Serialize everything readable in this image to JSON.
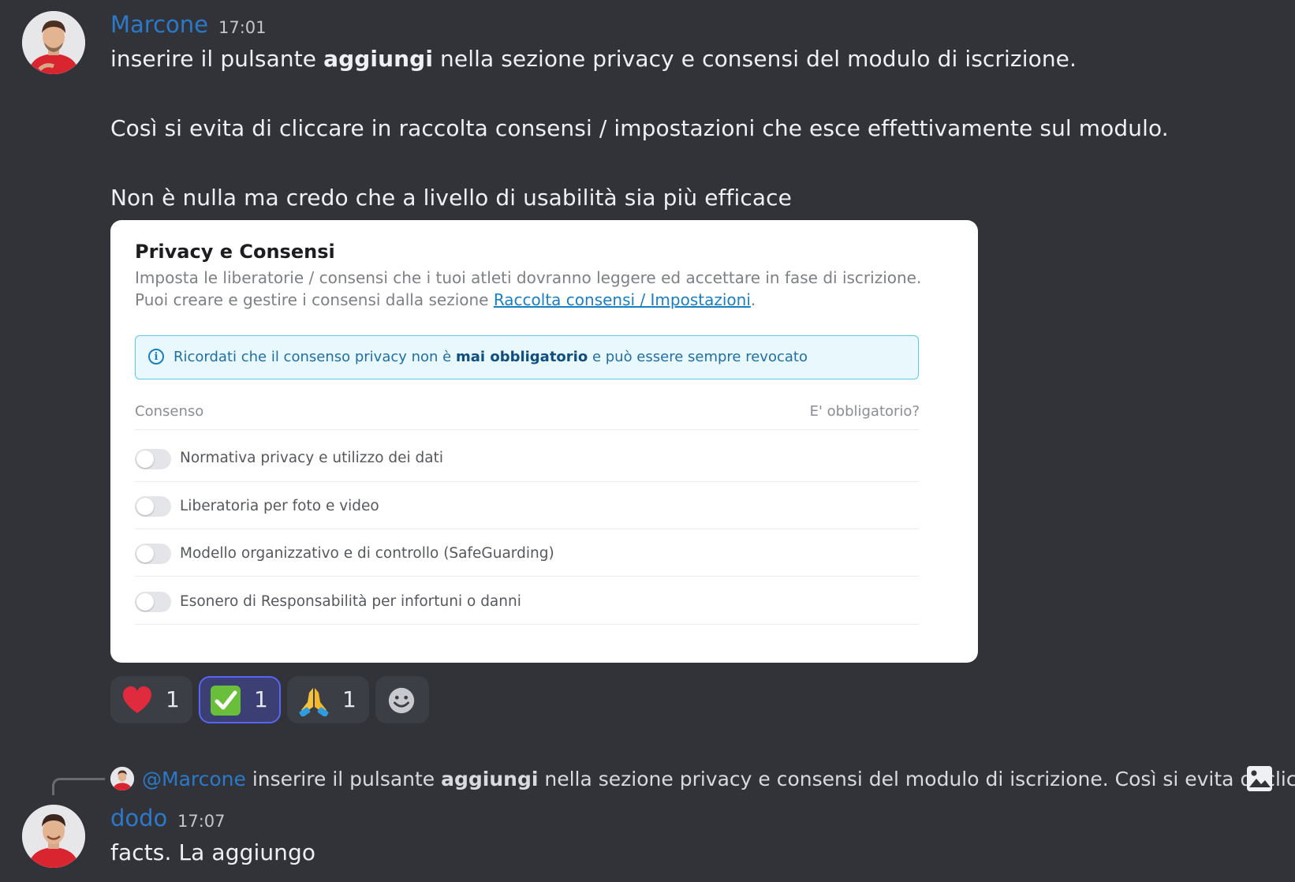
{
  "messages": [
    {
      "author": "Marcone",
      "time": "17:01",
      "lines": {
        "l1_pre": "inserire il pulsante ",
        "l1_bold": "aggiungi",
        "l1_post": " nella sezione privacy e consensi del modulo di iscrizione.",
        "l2": "Così si evita di cliccare in raccolta consensi / impostazioni che esce effettivamente sul modulo.",
        "l3": "Non è nulla ma credo che a livello di usabilità sia più efficace"
      }
    },
    {
      "author": "dodo",
      "time": "17:07",
      "text": "facts. La aggiungo"
    }
  ],
  "embed": {
    "title": "Privacy e Consensi",
    "desc_line1": "Imposta le liberatorie / consensi che i tuoi atleti dovranno leggere ed accettare in fase di iscrizione.",
    "desc_line2_pre": "Puoi creare e gestire i consensi dalla sezione ",
    "desc_link": "Raccolta consensi / Impostazioni",
    "desc_line2_post": ".",
    "info_pre": "Ricordati che il consenso privacy non è ",
    "info_bold": "mai obbligatorio",
    "info_post": " e può essere sempre revocato",
    "col_consent": "Consenso",
    "col_required": "E' obbligatorio?",
    "rows": [
      "Normativa privacy e utilizzo dei dati",
      "Liberatoria per foto e video",
      "Modello organizzativo e di controllo (SafeGuarding)",
      "Esonero di Responsabilità per infortuni o danni"
    ]
  },
  "reactions": [
    {
      "emoji": "heart-emoji",
      "count": "1",
      "active": false
    },
    {
      "emoji": "check-mark-emoji",
      "count": "1",
      "active": true
    },
    {
      "emoji": "folded-hands-emoji",
      "count": "1",
      "active": false
    }
  ],
  "add_reaction_icon": "smiley-icon",
  "reply": {
    "mention": "@Marcone",
    "pre": " inserire il pulsante ",
    "bold": "aggiungi",
    "post": " nella sezione privacy e consensi del modulo di iscrizione.  Così si evita di clic…",
    "attachment_icon": "image-icon"
  },
  "colors": {
    "background": "#323339",
    "username": "#2b79c9",
    "active_reaction_border": "#5865f2",
    "link": "#1a7fc1"
  }
}
